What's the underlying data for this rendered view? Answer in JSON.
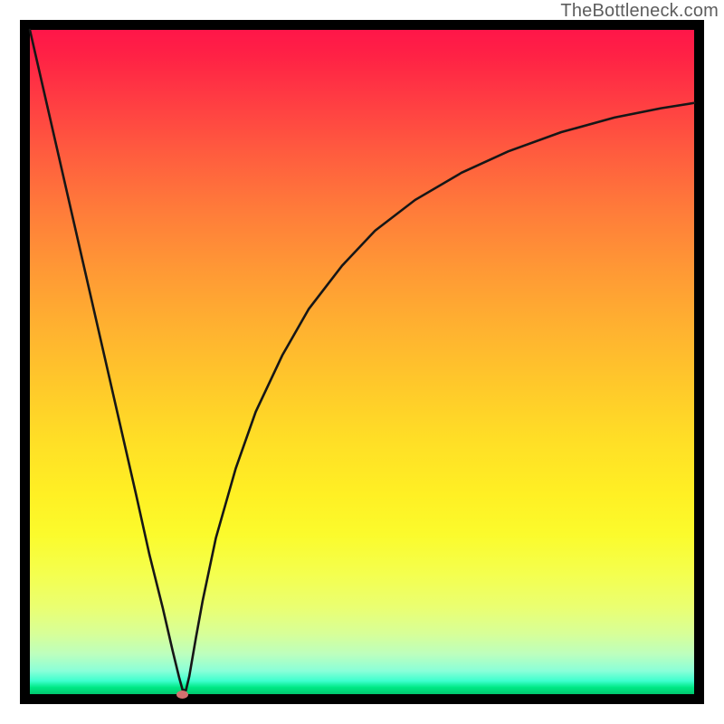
{
  "attribution": "TheBottleneck.com",
  "colors": {
    "curve": "#161616",
    "marker": "#d2706f",
    "frame": "#000000"
  },
  "chart_data": {
    "type": "line",
    "title": "",
    "xlabel": "",
    "ylabel": "",
    "xlim": [
      0,
      100
    ],
    "ylim": [
      0,
      100
    ],
    "x": [
      0,
      4,
      8,
      12,
      16,
      18,
      20,
      21.5,
      22.5,
      23,
      23.5,
      24,
      25,
      26,
      28,
      31,
      34,
      38,
      42,
      47,
      52,
      58,
      65,
      72,
      80,
      88,
      95,
      100
    ],
    "values": [
      100,
      82.5,
      65,
      47.5,
      30,
      21,
      13,
      6.5,
      2.4,
      0.6,
      0.6,
      2.7,
      8.5,
      14,
      23.5,
      34,
      42.5,
      51,
      58,
      64.5,
      69.8,
      74.4,
      78.5,
      81.7,
      84.6,
      86.8,
      88.2,
      89
    ],
    "marker": {
      "x": 23,
      "y": 0
    },
    "grid": false,
    "legend": false
  }
}
